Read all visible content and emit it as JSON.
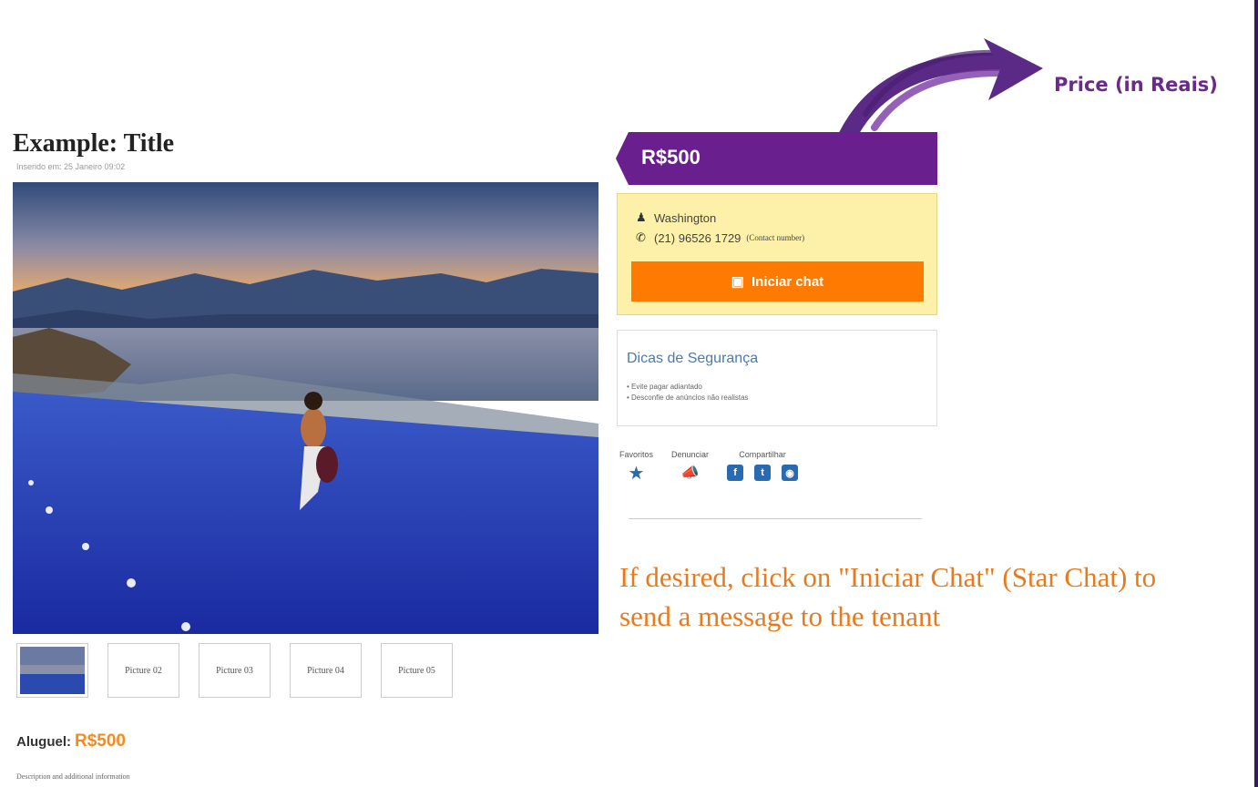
{
  "annotation": {
    "price_label": "Price (in Reais)",
    "instruction": "If desired, click on \"Iniciar Chat\" (Star Chat) to send a message to the tenant"
  },
  "listing": {
    "title": "Example: Title",
    "posted": "Inserido em: 25 Janeiro 09:02",
    "thumbnails": [
      "",
      "Picture 02",
      "Picture 03",
      "Picture 04",
      "Picture 05"
    ],
    "rent_label": "Aluguel:",
    "rent_value": "R$500",
    "description": "Description and additional information"
  },
  "sidebar": {
    "price": "R$500",
    "contact_name": "Washington",
    "contact_phone": "(21) 96526 1729",
    "contact_note": "(Contact number)",
    "chat_button": "Iniciar chat",
    "security_title": "Dicas de Segurança",
    "security_tips": [
      "Evite pagar adiantado",
      "Desconfie de anúncios não realistas"
    ],
    "actions": {
      "favorite": "Favoritos",
      "report": "Denunciar",
      "share": "Compartilhar"
    }
  },
  "colors": {
    "purple": "#6a1f8f",
    "orange": "#ff7a00",
    "contact_bg": "#fdf0a8",
    "accent_text": "#e87a1e",
    "icon_blue": "#2a6ab0"
  },
  "icons": [
    "arrow-brush-icon",
    "user-icon",
    "phone-icon",
    "chat-icon",
    "star-icon",
    "megaphone-icon",
    "facebook-icon",
    "twitter-icon",
    "share-icon"
  ]
}
